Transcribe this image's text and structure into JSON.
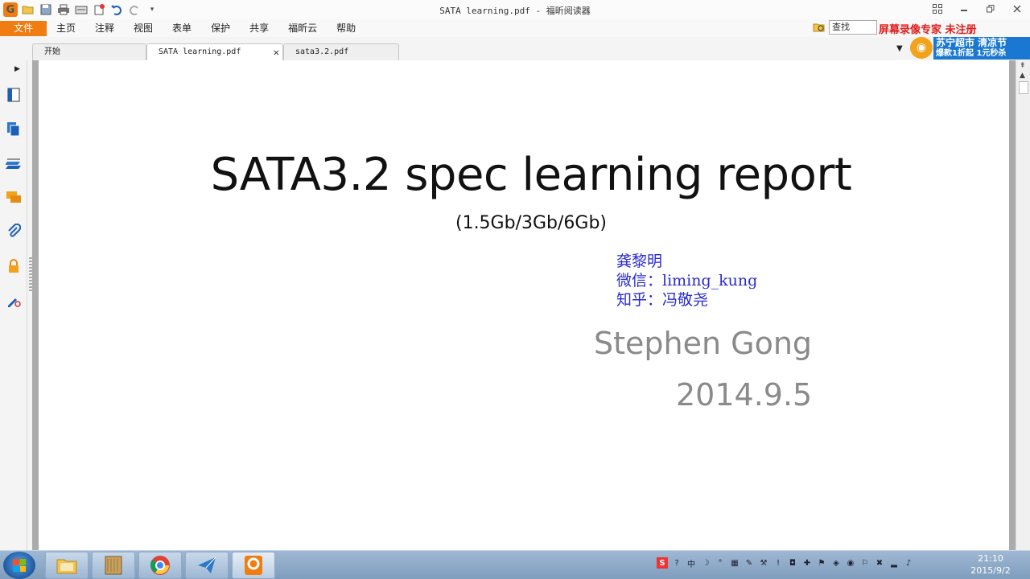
{
  "window": {
    "title": "SATA learning.pdf - 福昕阅读器"
  },
  "quick_access": {
    "icons": [
      "app-logo",
      "open-icon",
      "save-icon",
      "print-icon",
      "scan-icon",
      "new-icon",
      "undo-icon",
      "redo-icon",
      "customize-icon"
    ]
  },
  "menu": {
    "file_label": "文件",
    "items": [
      "主页",
      "注释",
      "视图",
      "表单",
      "保护",
      "共享",
      "福昕云",
      "帮助"
    ]
  },
  "search": {
    "placeholder": "查找"
  },
  "overlay": {
    "watermark": "屏幕录像专家 未注册"
  },
  "ad": {
    "line1": "苏宁超市 清凉节",
    "line2": "爆款1折起 1元秒杀"
  },
  "tabs": [
    {
      "label": "开始"
    },
    {
      "label": "SATA learning.pdf"
    },
    {
      "label": "sata3.2.pdf"
    }
  ],
  "document": {
    "title": "SATA3.2 spec learning report",
    "subtitle": "(1.5Gb/3Gb/6Gb)",
    "author_cn": "龚黎明",
    "wechat": "微信：liming_kung",
    "zhihu": "知乎：冯敬尧",
    "author_en": "Stephen Gong",
    "date": "2014.9.5"
  },
  "taskbar": {
    "time": "21:10",
    "date": "2015/9/2"
  },
  "colors": {
    "accent": "#ef7d12",
    "author_blue": "#2a2ad0",
    "gray_text": "#8a8a8a"
  }
}
